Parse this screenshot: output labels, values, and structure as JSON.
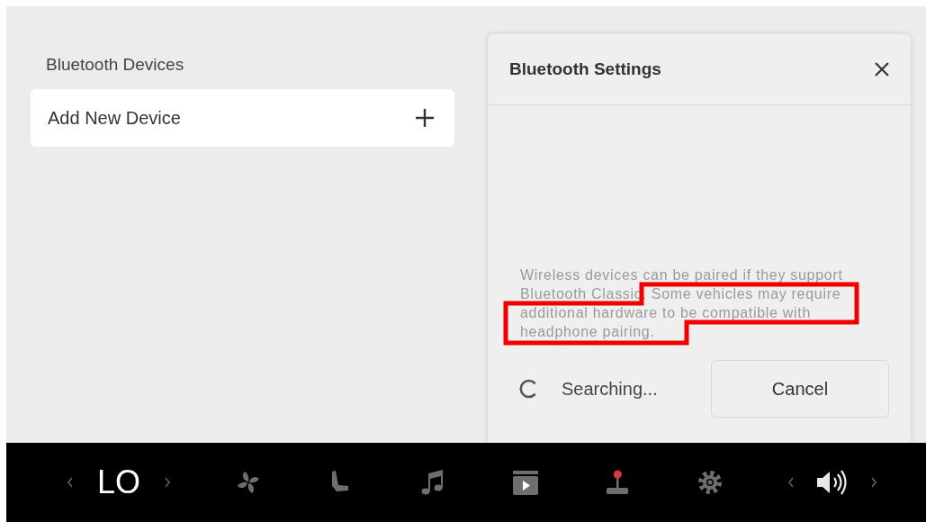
{
  "devices_section": {
    "title": "Bluetooth Devices",
    "add_button": {
      "label": "Add New Device"
    }
  },
  "settings_panel": {
    "title": "Bluetooth Settings",
    "note": "Wireless devices can be paired if they support Bluetooth Classic. Some vehicles may require additional hardware to be compatible with headphone pairing.",
    "note_highlighted": true,
    "status": "Searching...",
    "cancel_button": "Cancel"
  },
  "bottom_bar": {
    "temperature": "LO",
    "items": [
      {
        "kind": "fan"
      },
      {
        "kind": "seat"
      },
      {
        "kind": "music"
      },
      {
        "kind": "video"
      },
      {
        "kind": "joystick"
      },
      {
        "kind": "gear"
      }
    ]
  }
}
